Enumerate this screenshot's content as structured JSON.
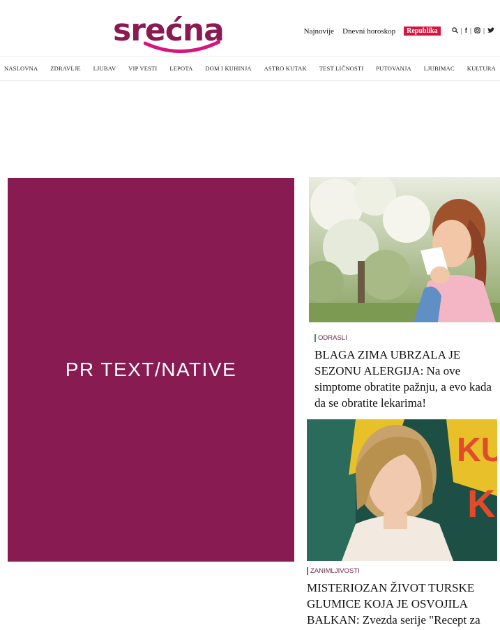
{
  "brand": {
    "logo_text": "srećna",
    "accent": "#881b52",
    "smile_color": "#d9147c"
  },
  "top_links": {
    "latest": "Najnovije",
    "horoscope": "Dnevni horoskop",
    "republika": "Republika"
  },
  "social_icons": [
    "search-icon",
    "facebook-icon",
    "instagram-icon",
    "twitter-icon"
  ],
  "nav": {
    "items": [
      "NASLOVNA",
      "ZDRAVLJE",
      "LJUBAV",
      "VIP VESTI",
      "LEPOTA",
      "DOM I KUHINJA",
      "ASTRO KUTAK",
      "TEST LIČNOSTI",
      "PUTOVANJA",
      "LJUBIMAC",
      "KULTURA"
    ]
  },
  "promo": {
    "label": "PR TEXT/NATIVE"
  },
  "articles": [
    {
      "category": "ODRASLI",
      "title": "BLAGA ZIMA UBRZALA JE SEZONU ALERGIJA: Na ove simptome obratite pažnju, a evo kada da se obratite lekarima!"
    },
    {
      "category": "ZANIMLJIVOSTI",
      "title": "MISTERIOZAN ŽIVOT TURSKE GLUMICE KOJA JE OSVOJILA BALKAN: Zvezda serije \"Recept za"
    }
  ]
}
